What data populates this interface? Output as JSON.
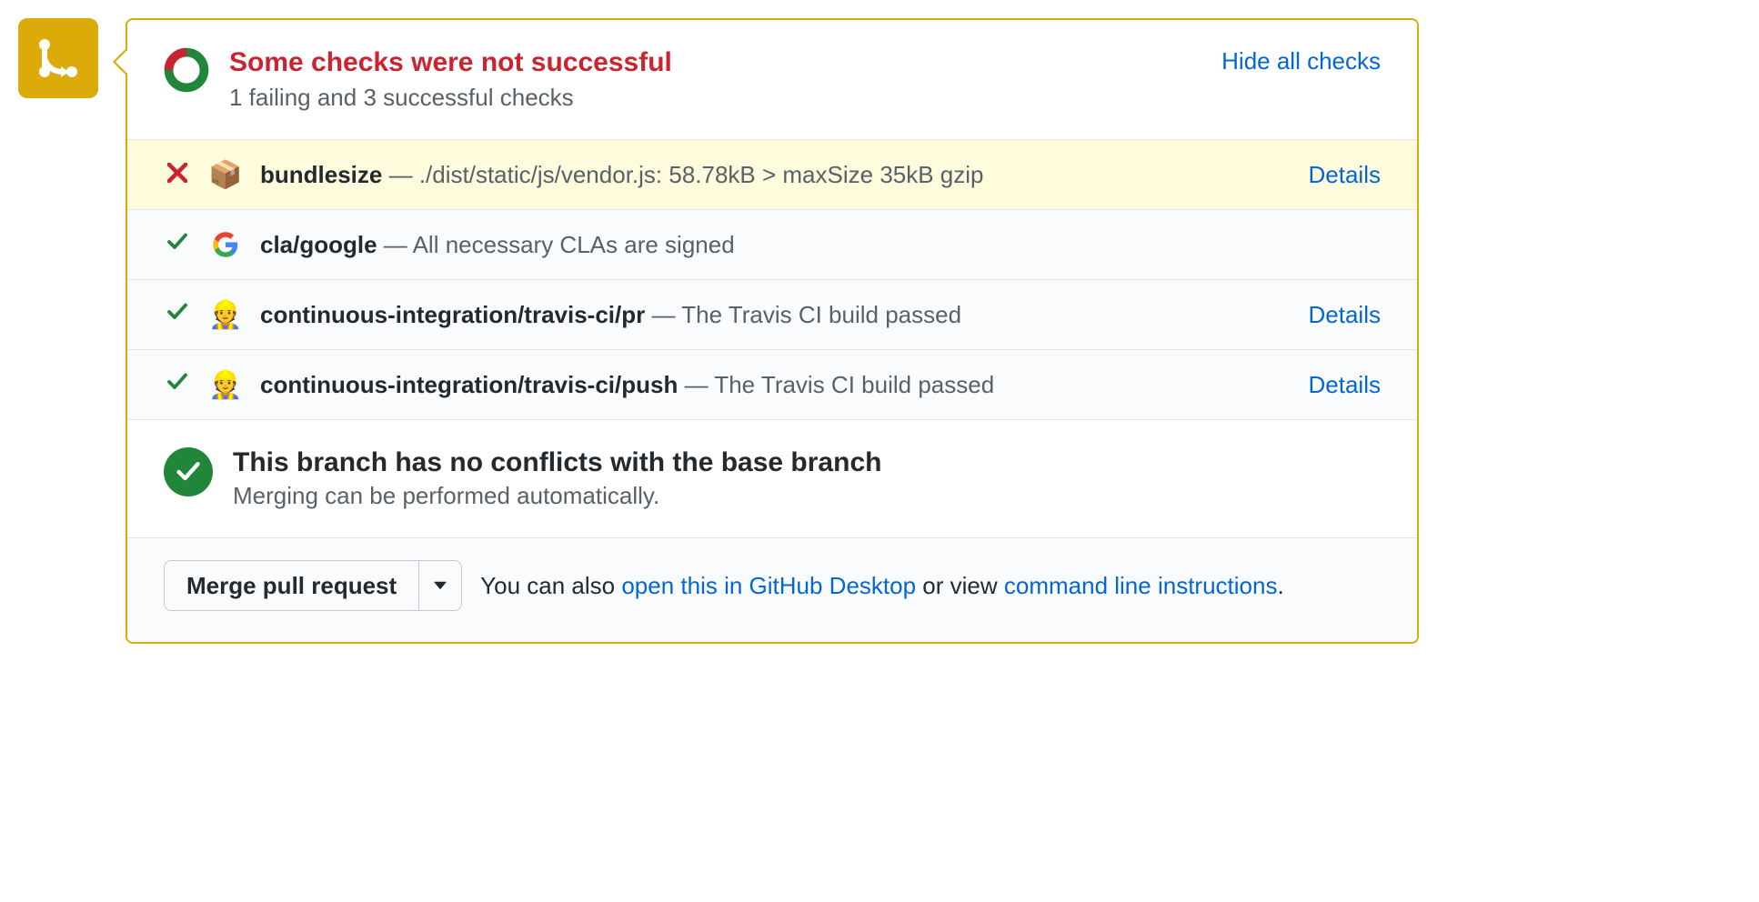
{
  "status": {
    "title": "Some checks were not successful",
    "subtitle": "1 failing and 3 successful checks",
    "hide_label": "Hide all checks"
  },
  "checks": [
    {
      "state": "fail",
      "icon": "📦",
      "name": "bundlesize",
      "sep": " — ",
      "desc": "./dist/static/js/vendor.js: 58.78kB > maxSize 35kB gzip",
      "details": "Details"
    },
    {
      "state": "pass",
      "icon": "G",
      "name": "cla/google",
      "sep": " — ",
      "desc": "All necessary CLAs are signed",
      "details": ""
    },
    {
      "state": "pass",
      "icon": "👷",
      "name": "continuous-integration/travis-ci/pr",
      "sep": " — ",
      "desc": "The Travis CI build passed",
      "details": "Details"
    },
    {
      "state": "pass",
      "icon": "👷",
      "name": "continuous-integration/travis-ci/push",
      "sep": " — ",
      "desc": "The Travis CI build passed",
      "details": "Details"
    }
  ],
  "merge": {
    "title": "This branch has no conflicts with the base branch",
    "subtitle": "Merging can be performed automatically."
  },
  "footer": {
    "button_label": "Merge pull request",
    "hint_prefix": "You can also ",
    "link1": "open this in GitHub Desktop",
    "hint_mid": " or view ",
    "link2": "command line instructions",
    "hint_suffix": "."
  }
}
